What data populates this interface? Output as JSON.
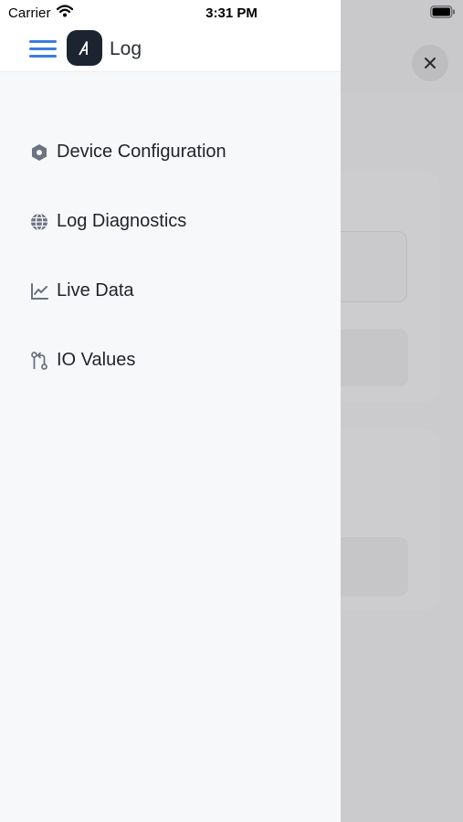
{
  "status_bar": {
    "carrier": "Carrier",
    "time": "3:31 PM"
  },
  "header": {
    "title": "Log",
    "logo_icon": "app-logo-a-icon",
    "menu_icon": "hamburger-menu-icon"
  },
  "nav": {
    "items": [
      {
        "label": "Device Configuration",
        "icon": "hexagon-icon"
      },
      {
        "label": "Log Diagnostics",
        "icon": "globe-icon"
      },
      {
        "label": "Live Data",
        "icon": "line-chart-icon"
      },
      {
        "label": "IO Values",
        "icon": "git-compare-icon"
      }
    ]
  },
  "colors": {
    "accent": "#3a7be0",
    "drawer_bg": "#f7f8fa",
    "scrim": "#c9c9cb",
    "icon": "#6b7280",
    "logo_bg": "#1b2430"
  }
}
